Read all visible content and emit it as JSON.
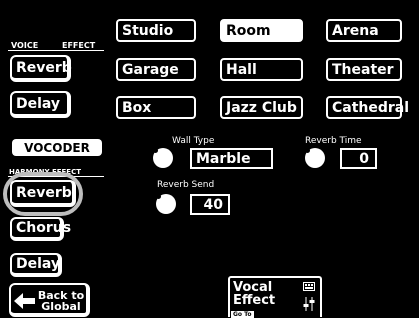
{
  "sidebar": {
    "voice_effect_label_left": "VOICE",
    "voice_effect_label_right": "EFFECT",
    "reverb": "Reverb",
    "delay": "Delay",
    "vocoder": "VOCODER",
    "harmony_effect_label": "HARMONY EFFECT",
    "harmony_reverb": "Reverb",
    "chorus": "Chorus",
    "harmony_delay": "Delay",
    "back_line1": "Back to",
    "back_line2": "Global"
  },
  "room_types": [
    {
      "label": "Studio",
      "selected": false
    },
    {
      "label": "Room",
      "selected": true
    },
    {
      "label": "Arena",
      "selected": false
    },
    {
      "label": "Garage",
      "selected": false
    },
    {
      "label": "Hall",
      "selected": false
    },
    {
      "label": "Theater",
      "selected": false
    },
    {
      "label": "Box",
      "selected": false
    },
    {
      "label": "Jazz Club",
      "selected": false
    },
    {
      "label": "Cathedral",
      "selected": false
    }
  ],
  "params": {
    "wall_type_label": "Wall Type",
    "wall_type_value": "Marble",
    "reverb_time_label": "Reverb Time",
    "reverb_time_value": "0",
    "reverb_send_label": "Reverb Send",
    "reverb_send_value": "40"
  },
  "goto": {
    "line1": "Vocal",
    "line2": "Effect",
    "tag": "Go To"
  },
  "colors": {
    "background": "#000000",
    "foreground": "#ffffff",
    "highlight_ring": "#bdbdbd"
  }
}
